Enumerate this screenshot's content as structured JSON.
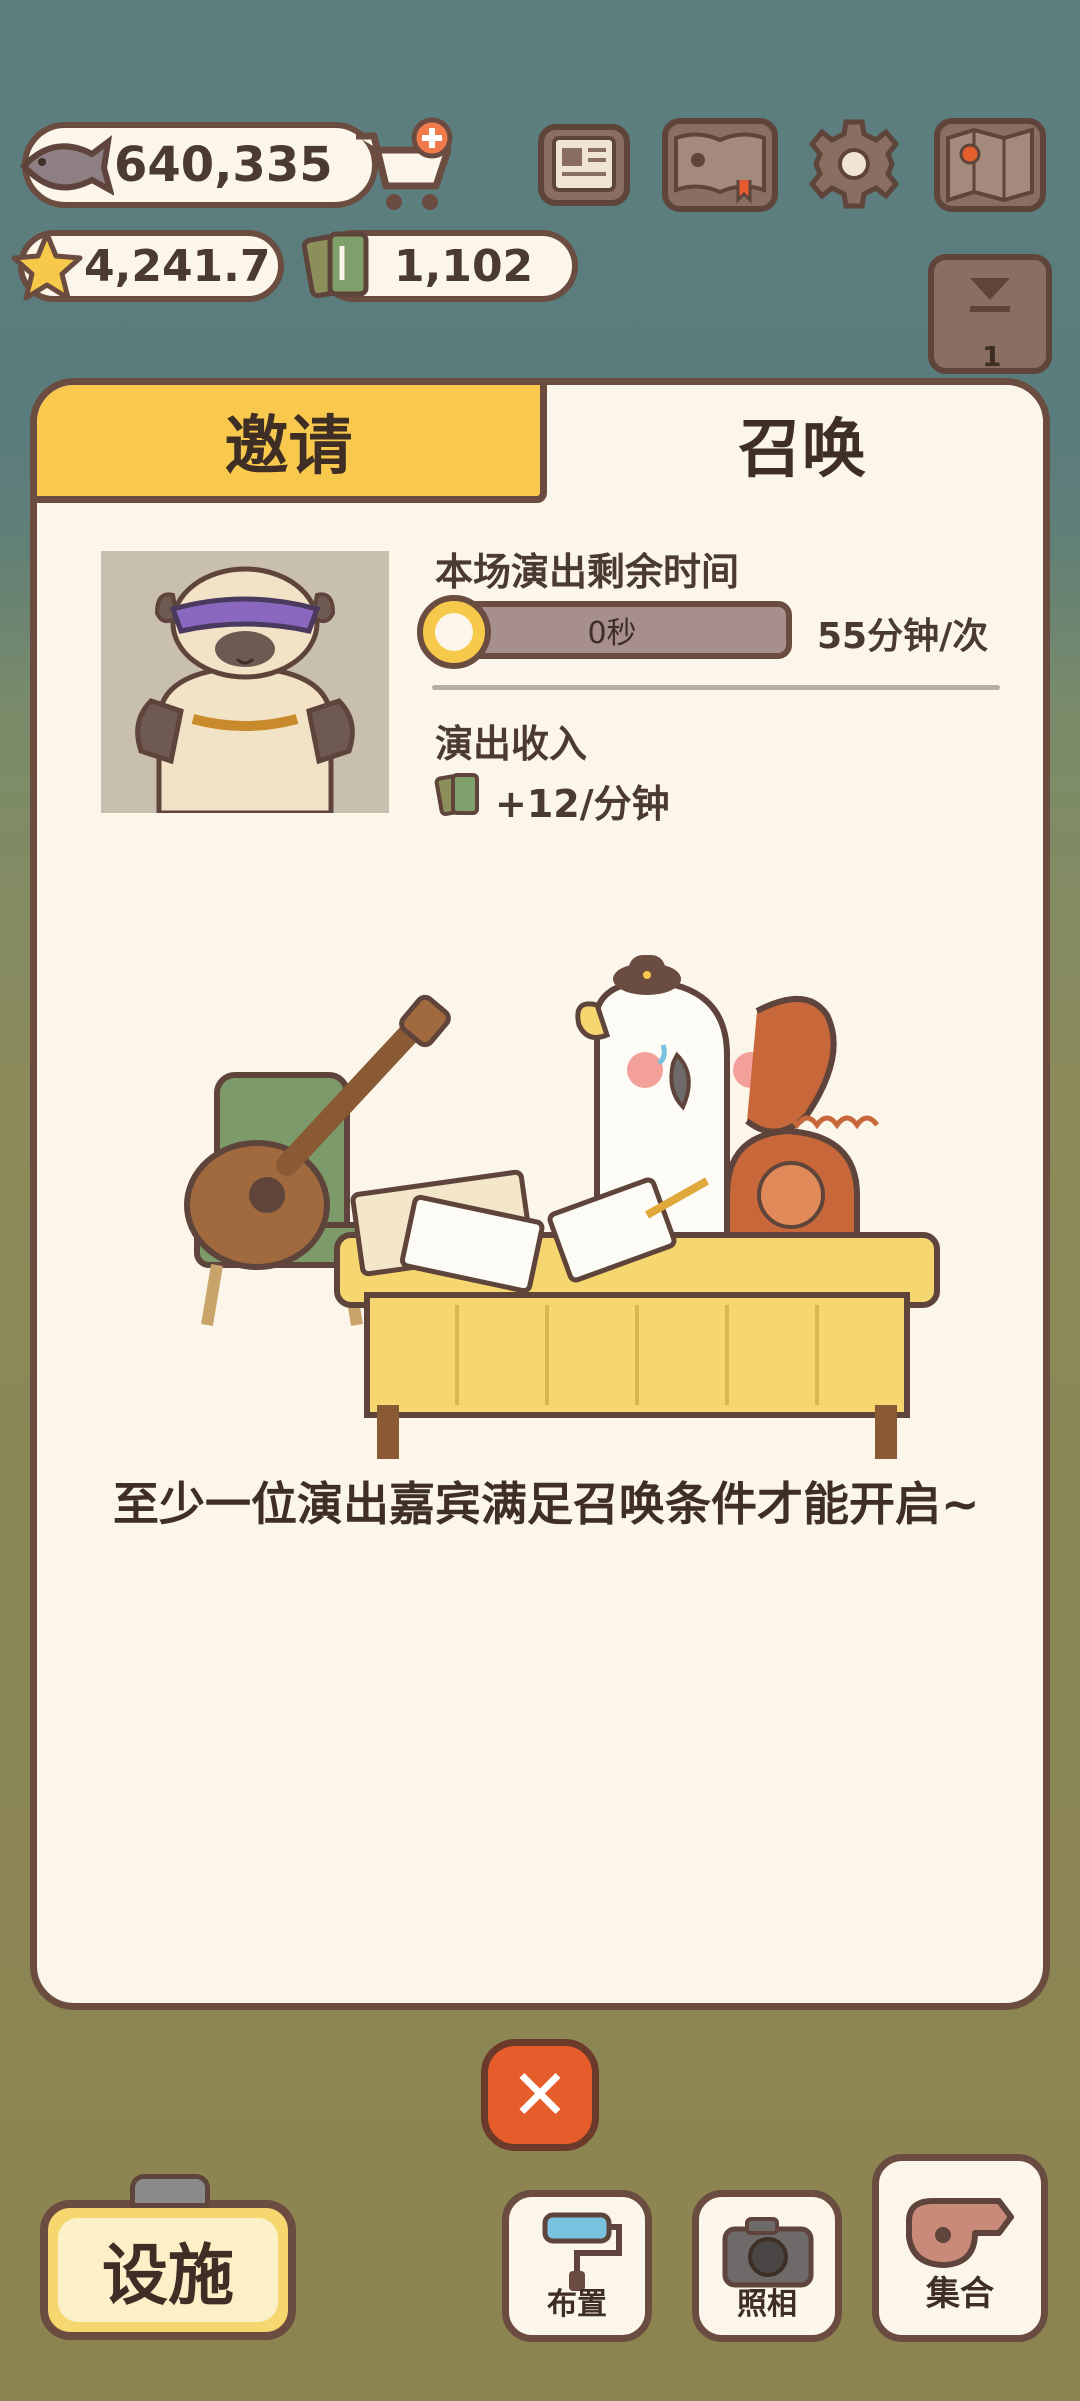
{
  "currencies": {
    "fish": "640,335",
    "stars": "4,241.7",
    "tickets": "1,102"
  },
  "top_icons": [
    "newspaper-icon",
    "album-icon",
    "settings-gear-icon",
    "map-icon"
  ],
  "side_badge": "1",
  "tabs": {
    "invite": "邀请",
    "summon": "召唤"
  },
  "show": {
    "remaining_label": "本场演出剩余时间",
    "remaining_value": "0秒",
    "rate": "55分钟/次",
    "income_label": "演出收入",
    "income_value": "+12/分钟"
  },
  "message": "至少一位演出嘉宾满足召唤条件才能开启~",
  "bottom": {
    "facility": "设施",
    "layout": "布置",
    "photo": "照相",
    "gather": "集合"
  },
  "colors": {
    "tab_active_bg": "#f8c94c",
    "panel_bg": "#fbf5ea",
    "border": "#6b4c40",
    "close_button": "#e55d2a"
  }
}
